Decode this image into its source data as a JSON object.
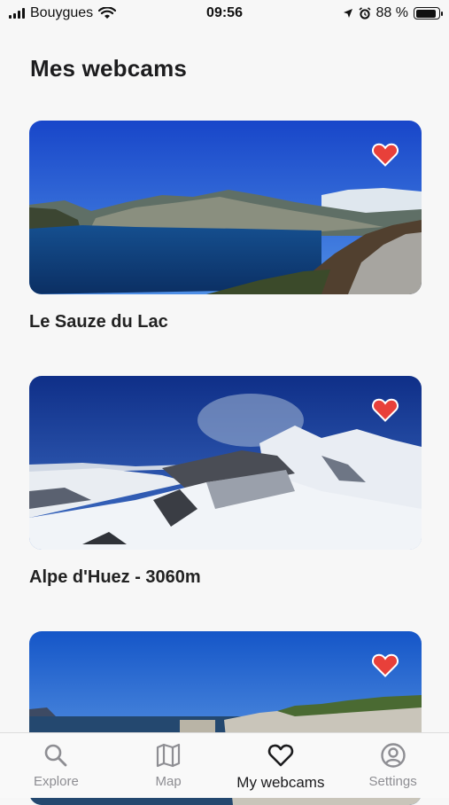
{
  "status": {
    "carrier": "Bouygues",
    "time": "09:56",
    "battery": "88 %",
    "battery_level": 0.88
  },
  "page": {
    "title": "Mes webcams"
  },
  "webcams": [
    {
      "name": "Le Sauze du Lac",
      "favorite": true
    },
    {
      "name": "Alpe d'Huez - 3060m",
      "favorite": true
    },
    {
      "name": "",
      "favorite": true
    }
  ],
  "tabs": [
    {
      "label": "Explore",
      "icon": "search-icon",
      "active": false
    },
    {
      "label": "Map",
      "icon": "map-icon",
      "active": false
    },
    {
      "label": "My webcams",
      "icon": "heart-icon",
      "active": true
    },
    {
      "label": "Settings",
      "icon": "user-circle-icon",
      "active": false
    }
  ],
  "colors": {
    "favorite": "#e8403a",
    "active_tab": "#1c1c1e",
    "inactive_tab": "#8e8e93"
  }
}
